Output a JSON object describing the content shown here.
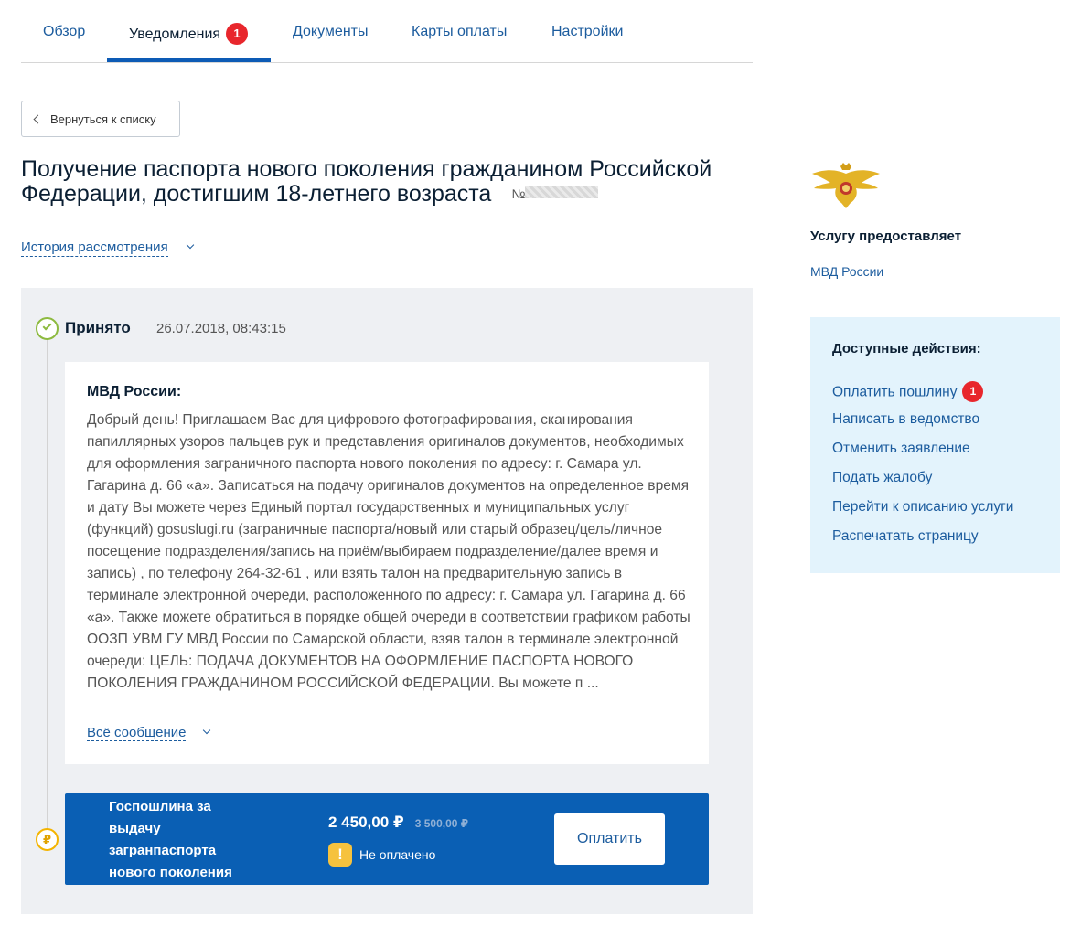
{
  "tabs": [
    {
      "label": "Обзор"
    },
    {
      "label": "Уведомления",
      "badge": "1"
    },
    {
      "label": "Документы"
    },
    {
      "label": "Карты оплаты"
    },
    {
      "label": "Настройки"
    }
  ],
  "back_button": "Вернуться к списку",
  "title": "Получение паспорта нового поколения гражданином Российской Федерации, достигшим 18-летнего возраста",
  "number_label": "№",
  "history_link": "История рассмотрения",
  "status": {
    "title": "Принято",
    "date": "26.07.2018, 08:43:15"
  },
  "message": {
    "author": "МВД России:",
    "text": "Добрый день! Приглашаем Вас для цифрового фотографирования, сканирования папиллярных узоров пальцев рук и представления оригиналов документов, необходимых для оформления заграничного паспорта нового поколения по адресу: г. Самара ул. Гагарина д. 66 «а». Записаться на подачу оригиналов документов на определенное время и дату Вы можете через Единый портал государственных и муниципальных услуг (функций) gosuslugi.ru (заграничные паспорта/новый или старый образец/цель/личное посещение подразделения/запись на приём/выбираем подразделение/далее время и запись) , по телефону 264-32-61 , или взять талон на предварительную запись в терминале электронной очереди, расположенного по адресу: г. Самара ул. Гагарина д. 66 «а». Также можете обратиться в порядке общей очереди в соответствии графиком работы ООЗП УВМ ГУ МВД России по Самарской области, взяв талон в терминале электронной очереди: ЦЕЛЬ: ПОДАЧА ДОКУМЕНТОВ НА ОФОРМЛЕНИЕ ПАСПОРТА НОВОГО ПОКОЛЕНИЯ ГРАЖДАНИНОМ РОССИЙСКОЙ ФЕДЕРАЦИИ. Вы можете п ...",
    "expand_link": "Всё сообщение"
  },
  "fee": {
    "icon": "₽",
    "title": "Госпошлина за выдачу загранпаспорта нового поколения",
    "price": "2 450,00 ₽",
    "old_price": "3 500,00 ₽",
    "warning_icon": "!",
    "status": "Не оплачено",
    "pay_button": "Оплатить"
  },
  "provider": {
    "label": "Услугу предоставляет",
    "name": "МВД России"
  },
  "actions": {
    "title": "Доступные действия:",
    "items": [
      {
        "label": "Оплатить пошлину",
        "badge": "1"
      },
      {
        "label": "Написать в ведомство"
      },
      {
        "label": "Отменить заявление"
      },
      {
        "label": "Подать жалобу"
      },
      {
        "label": "Перейти к описанию услуги"
      },
      {
        "label": "Распечатать страницу"
      }
    ]
  },
  "colors": {
    "link": "#1c5c9e",
    "badge": "#e8262c",
    "fee_bar": "#0a5fb4",
    "panel": "#eef0f3",
    "actions_bg": "#e3f3fc",
    "status_ok": "#8dba3f",
    "warning": "#f6c23e"
  }
}
